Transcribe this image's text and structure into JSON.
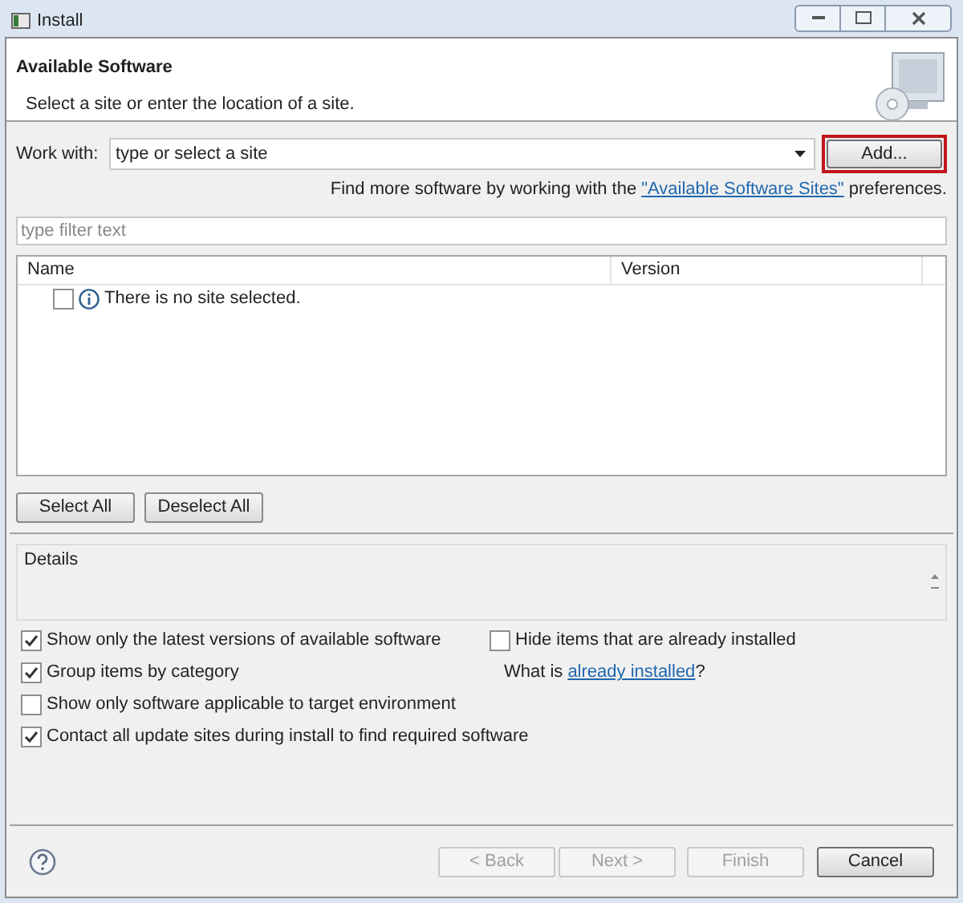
{
  "window": {
    "title": "Install"
  },
  "header": {
    "title": "Available Software",
    "subtitle": "Select a site or enter the location of a site."
  },
  "work_with": {
    "label": "Work with:",
    "placeholder": "type or select a site"
  },
  "add_button": {
    "label": "Add...",
    "highlighted": true
  },
  "find_more": {
    "before": "Find more software by working with the",
    "link": "\"Available Software Sites\"",
    "after": "preferences."
  },
  "filter": {
    "placeholder": "type filter text"
  },
  "table": {
    "columns": [
      "Name",
      "Version"
    ],
    "rows": [
      {
        "name": "There is no site selected.",
        "checked": false
      }
    ]
  },
  "selection_buttons": [
    "Select All",
    "Deselect All"
  ],
  "details": {
    "label": "Details"
  },
  "options": [
    {
      "label": "Show only the latest versions of available software",
      "checked": true
    },
    {
      "label": "Group items by category",
      "checked": true
    },
    {
      "label": "Show only software applicable to target environment",
      "checked": false
    },
    {
      "label": "Contact all update sites during install to find required software",
      "checked": true
    }
  ],
  "hide_installed": {
    "label": "Hide items that are already installed",
    "checked": false
  },
  "what_is": {
    "before": "What is",
    "link": "already installed",
    "after": "?"
  },
  "footer_buttons": [
    {
      "label": "< Back",
      "disabled": true
    },
    {
      "label": "Next >",
      "disabled": true
    },
    {
      "label": "Finish",
      "disabled": true
    },
    {
      "label": "Cancel",
      "disabled": false
    }
  ]
}
